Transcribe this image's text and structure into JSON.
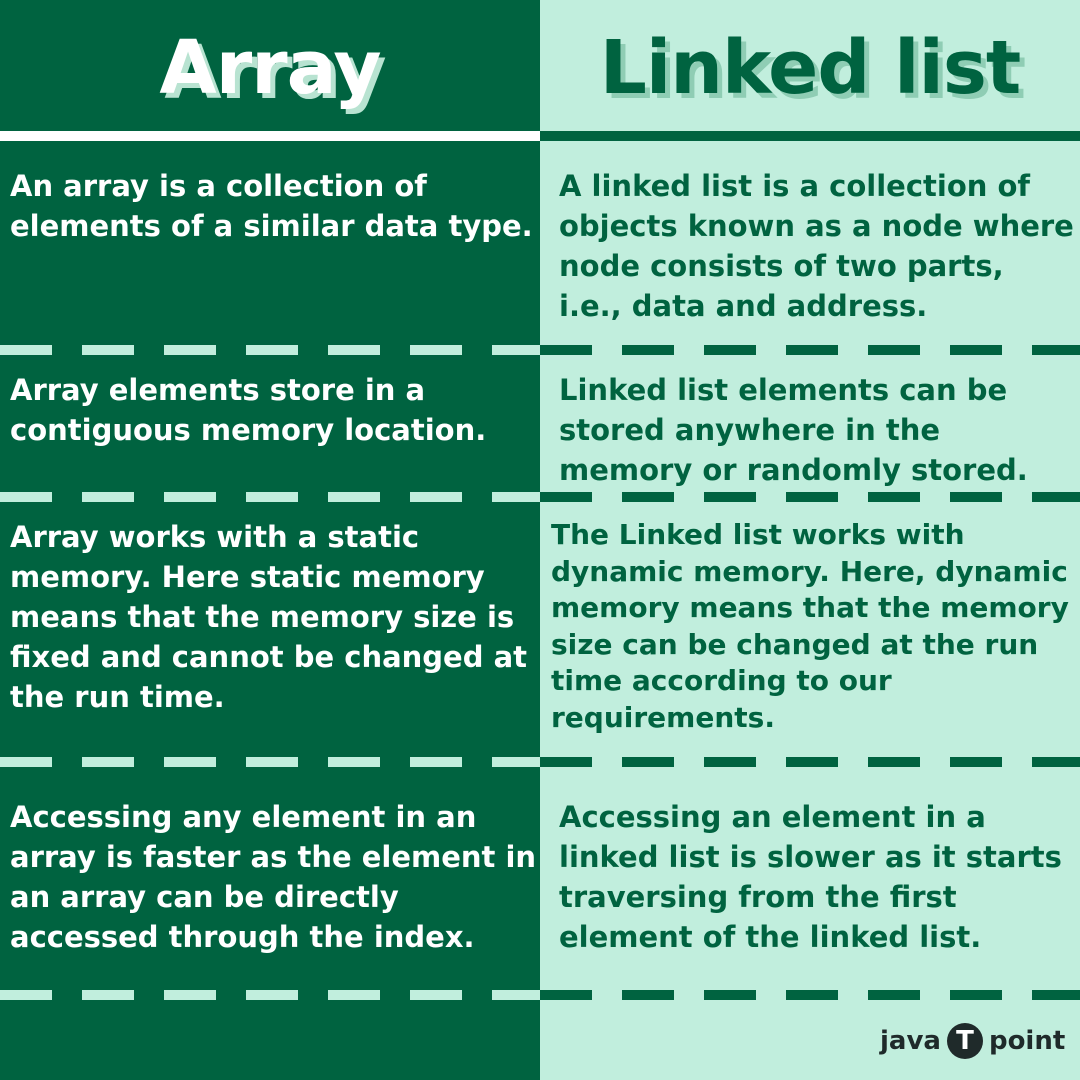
{
  "header": {
    "left_title": "Array",
    "right_title": "Linked list"
  },
  "rows": [
    {
      "array": "An array is a collection of elements of a similar data type.",
      "linked_list": "A linked list is a collection of objects known as a node where node consists of two parts, i.e., data and address."
    },
    {
      "array": "Array elements store in a contiguous memory location.",
      "linked_list": "Linked list elements can be stored anywhere in the memory or randomly stored."
    },
    {
      "array": "Array works with a static memory. Here static memory means that the memory size is fixed and cannot be changed at the run time.",
      "linked_list": "The Linked list works with dynamic memory. Here, dynamic memory means that the memory size can be changed at the run time according to our requirements."
    },
    {
      "array": "Accessing any element in an array is faster as the element in an array can be directly accessed through the index.",
      "linked_list": "Accessing an element in a linked list is slower as it starts traversing from the first element of the linked list."
    }
  ],
  "logo": {
    "left": "java",
    "mark": "T",
    "right": "point"
  },
  "colors": {
    "dark_green": "#006340",
    "mint": "#c1eedd",
    "white": "#ffffff"
  }
}
